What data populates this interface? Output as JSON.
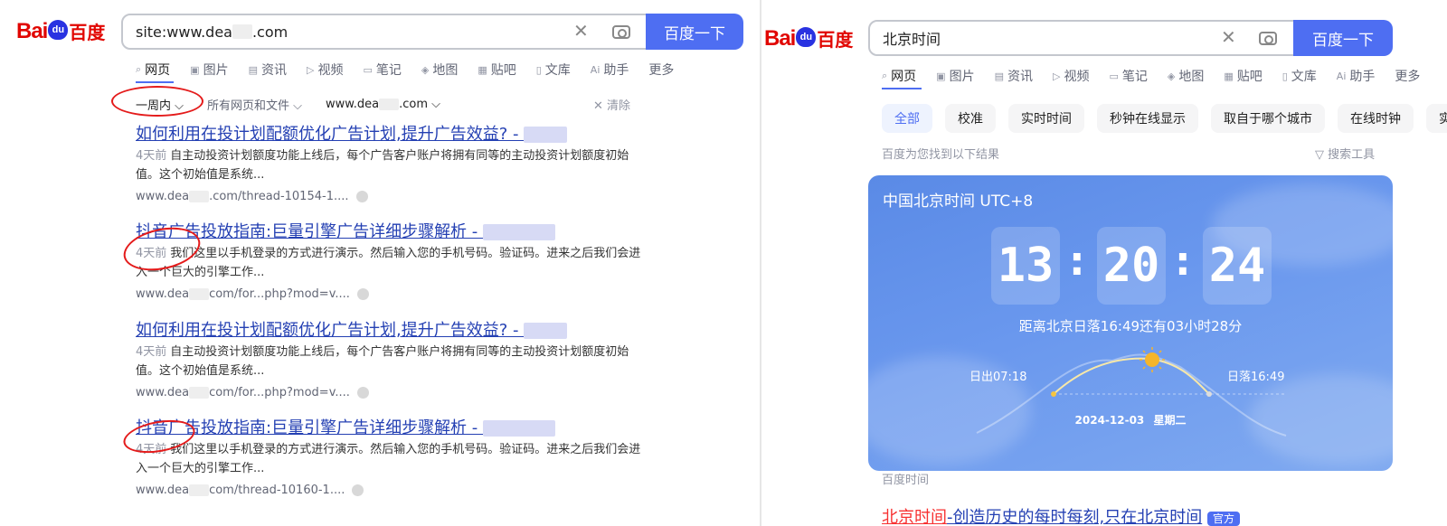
{
  "left": {
    "logo": {
      "latin": "Bai",
      "paw": "du",
      "cn": "百度"
    },
    "search": {
      "value": "site:www.dea",
      "value_tail": ".com",
      "button": "百度一下"
    },
    "tabs": [
      "网页",
      "图片",
      "资讯",
      "视频",
      "笔记",
      "地图",
      "贴吧",
      "文库",
      "助手",
      "更多"
    ],
    "filters": {
      "time": "一周内",
      "type": "所有网页和文件",
      "site_head": "www.dea",
      "site_tail": ".com",
      "clear": "清除"
    },
    "results": [
      {
        "title": "如何利用在投计划配额优化广告计划,提升广告效益? - ",
        "date": "4天前",
        "abstract": "自主动投资计划额度功能上线后，每个广告客户账户将拥有同等的主动投资计划额度初始值。这个初始值是系统...",
        "url_head": "www.dea",
        "url_tail": ".com/thread-10154-1...."
      },
      {
        "title": "抖音广告投放指南:巨量引擎广告详细步骤解析 - ",
        "date": "4天前",
        "abstract": "我们这里以手机登录的方式进行演示。然后输入您的手机号码。验证码。进来之后我们会进入一个巨大的引擎工作...",
        "url_head": "www.dea",
        "url_tail": "com/for...php?mod=v...."
      },
      {
        "title": "如何利用在投计划配额优化广告计划,提升广告效益? - ",
        "date": "4天前",
        "abstract": "自主动投资计划额度功能上线后，每个广告客户账户将拥有同等的主动投资计划额度初始值。这个初始值是系统...",
        "url_head": "www.dea",
        "url_tail": "com/for...php?mod=v...."
      },
      {
        "title": "抖音广告投放指南:巨量引擎广告详细步骤解析 - ",
        "date": "4天前",
        "abstract": "我们这里以手机登录的方式进行演示。然后输入您的手机号码。验证码。进来之后我们会进入一个巨大的引擎工作...",
        "url_head": "www.dea",
        "url_tail": "com/thread-10160-1...."
      }
    ]
  },
  "right": {
    "logo": {
      "latin": "Bai",
      "paw": "du",
      "cn": "百度"
    },
    "search": {
      "value": "北京时间",
      "button": "百度一下"
    },
    "tabs": [
      "网页",
      "图片",
      "资讯",
      "视频",
      "笔记",
      "地图",
      "贴吧",
      "文库",
      "助手",
      "更多"
    ],
    "pills": [
      "全部",
      "校准",
      "实时时间",
      "秒钟在线显示",
      "取自于哪个城市",
      "在线时钟",
      "实时"
    ],
    "found": "百度为您找到以下结果",
    "tools": "搜索工具",
    "card": {
      "title": "中国北京时间 UTC+8",
      "hh": "13",
      "mm": "20",
      "ss": "24",
      "sunset_text": "距离北京日落16:49还有03小时28分",
      "sunrise": "日出07:18",
      "sunset": "日落16:49",
      "date": "2024-12-03",
      "weekday": "星期二"
    },
    "source": "百度时间",
    "next_title_red": "北京时间",
    "next_title": "-创造历史的每时每刻,只在北京时间",
    "next_badge": "官方"
  },
  "colors": {
    "brand_blue": "#4e6ef2",
    "link": "#2440b3",
    "logo_red": "#e10601",
    "annotation_red": "#e41b1b"
  }
}
